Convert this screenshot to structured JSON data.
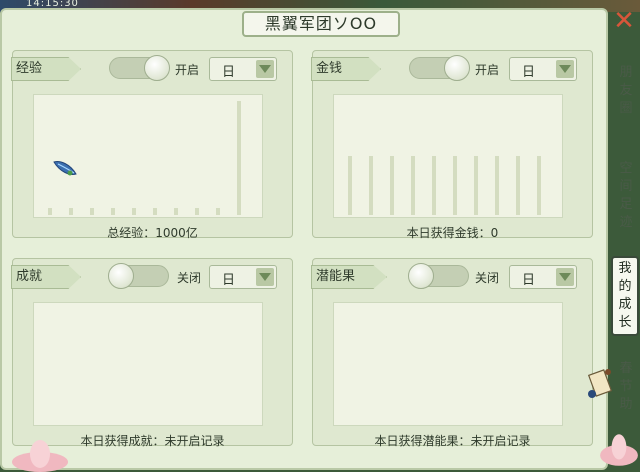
{
  "window": {
    "clock": "14:15:30",
    "title": "黑翼军团ソOO"
  },
  "cards": [
    {
      "tag": "经验",
      "switch_state": "开启",
      "period": "日",
      "caption": "总经验：1000亿",
      "chart_values": [
        0.06,
        0.06,
        0.06,
        0.06,
        0.06,
        0.06,
        0.06,
        0.06,
        0.06,
        1.0
      ]
    },
    {
      "tag": "金钱",
      "switch_state": "开启",
      "period": "日",
      "caption": "本日获得金钱：0",
      "chart_values": [
        0.52,
        0.52,
        0.52,
        0.52,
        0.52,
        0.52,
        0.52,
        0.52,
        0.52,
        0.52
      ]
    },
    {
      "tag": "成就",
      "switch_state": "关闭",
      "period": "日",
      "caption": "本日获得成就：未开启记录",
      "chart_values": []
    },
    {
      "tag": "潜能果",
      "switch_state": "关闭",
      "period": "日",
      "caption": "本日获得潜能果：未开启记录",
      "chart_values": []
    }
  ],
  "side_tabs": [
    {
      "label": "朋友圈",
      "active": false
    },
    {
      "label": "空间足迹",
      "active": false
    },
    {
      "label": "我的成长",
      "active": true
    },
    {
      "label": "春节助",
      "active": false
    }
  ],
  "colors": {
    "panel_bg": "#e6efd9",
    "bar_color": "#d4dcc0",
    "close_red": "#d8563a"
  },
  "icons": {
    "close": "close-icon",
    "dropdown": "chevron-down-icon",
    "scroll": "scroll-icon",
    "feather": "feather-icon"
  }
}
